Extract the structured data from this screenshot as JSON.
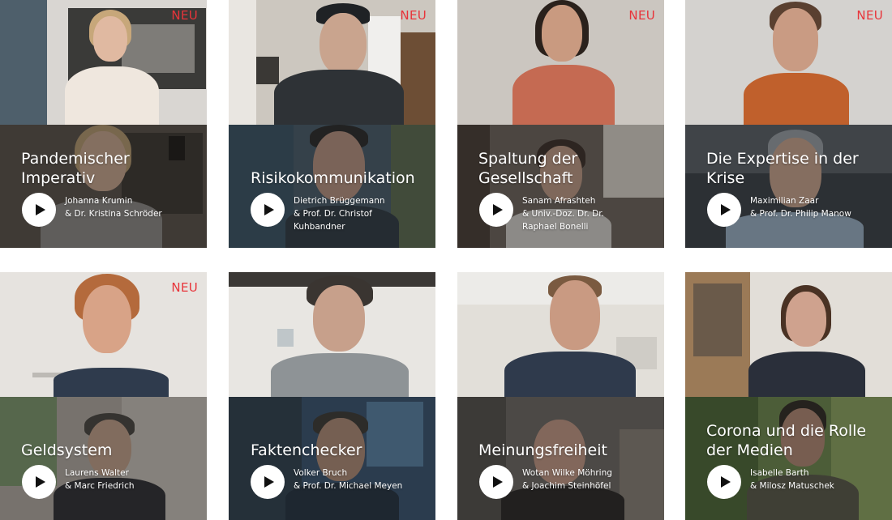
{
  "badge_label": "NEU",
  "cards": [
    {
      "title": "Pandemischer\nImperativ",
      "names": [
        "Johanna Krumin",
        "& Dr. Kristina Schröder"
      ],
      "is_new": true
    },
    {
      "title": "Risikokommunikation",
      "names": [
        "Dietrich Brüggemann",
        "& Prof. Dr. Christof",
        "Kuhbandner"
      ],
      "is_new": true
    },
    {
      "title": "Spaltung der\nGesellschaft",
      "names": [
        "Sanam Afrashteh",
        "& Univ.-Doz. Dr. Dr.",
        "Raphael Bonelli"
      ],
      "is_new": true
    },
    {
      "title": "Die Expertise in der\nKrise",
      "names": [
        "Maximilian Zaar",
        "& Prof. Dr. Philip Manow"
      ],
      "is_new": true
    },
    {
      "title": "Geldsystem",
      "names": [
        "Laurens Walter",
        "& Marc Friedrich"
      ],
      "is_new": true
    },
    {
      "title": "Faktenchecker",
      "names": [
        "Volker Bruch",
        "& Prof. Dr. Michael Meyen"
      ],
      "is_new": false
    },
    {
      "title": "Meinungsfreiheit",
      "names": [
        "Wotan Wilke Möhring",
        "& Joachim Steinhöfel"
      ],
      "is_new": false
    },
    {
      "title": "Corona und die Rolle\nder Medien",
      "names": [
        "Isabelle Barth",
        "& Milosz Matuschek"
      ],
      "is_new": false
    }
  ],
  "colors": {
    "badge": "#e8343a",
    "play_button": "#ffffff",
    "text": "#ffffff"
  },
  "icons": {
    "play": "play-icon"
  }
}
